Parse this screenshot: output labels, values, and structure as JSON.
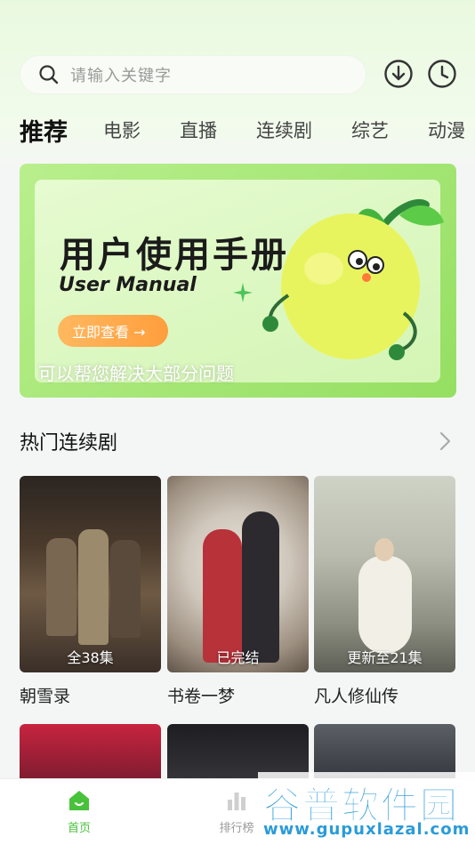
{
  "search": {
    "placeholder": "请输入关键字"
  },
  "header_icons": [
    "download-icon",
    "history-clock-icon"
  ],
  "tabs": [
    {
      "label": "推荐",
      "active": true
    },
    {
      "label": "电影"
    },
    {
      "label": "直播"
    },
    {
      "label": "连续剧"
    },
    {
      "label": "综艺"
    },
    {
      "label": "动漫"
    }
  ],
  "banner": {
    "title": "用户使用手册",
    "subtitle": "User Manual",
    "button_label": "立即查看 →",
    "description": "可以帮您解决大部分问题"
  },
  "section": {
    "title": "热门连续剧"
  },
  "shows": [
    {
      "title": "朝雪录",
      "badge": "全38集"
    },
    {
      "title": "书卷一梦",
      "badge": "已完结"
    },
    {
      "title": "凡人修仙传",
      "badge": "更新至21集"
    }
  ],
  "bottom_nav": [
    {
      "label": "首页",
      "active": true
    },
    {
      "label": "排行榜"
    }
  ],
  "watermark": {
    "text": "谷普软件园",
    "url": "www.gupuxlazal.com"
  },
  "colors": {
    "accent": "#48c23a",
    "banner_green": "#95df62",
    "button_orange": "#ffa445"
  }
}
